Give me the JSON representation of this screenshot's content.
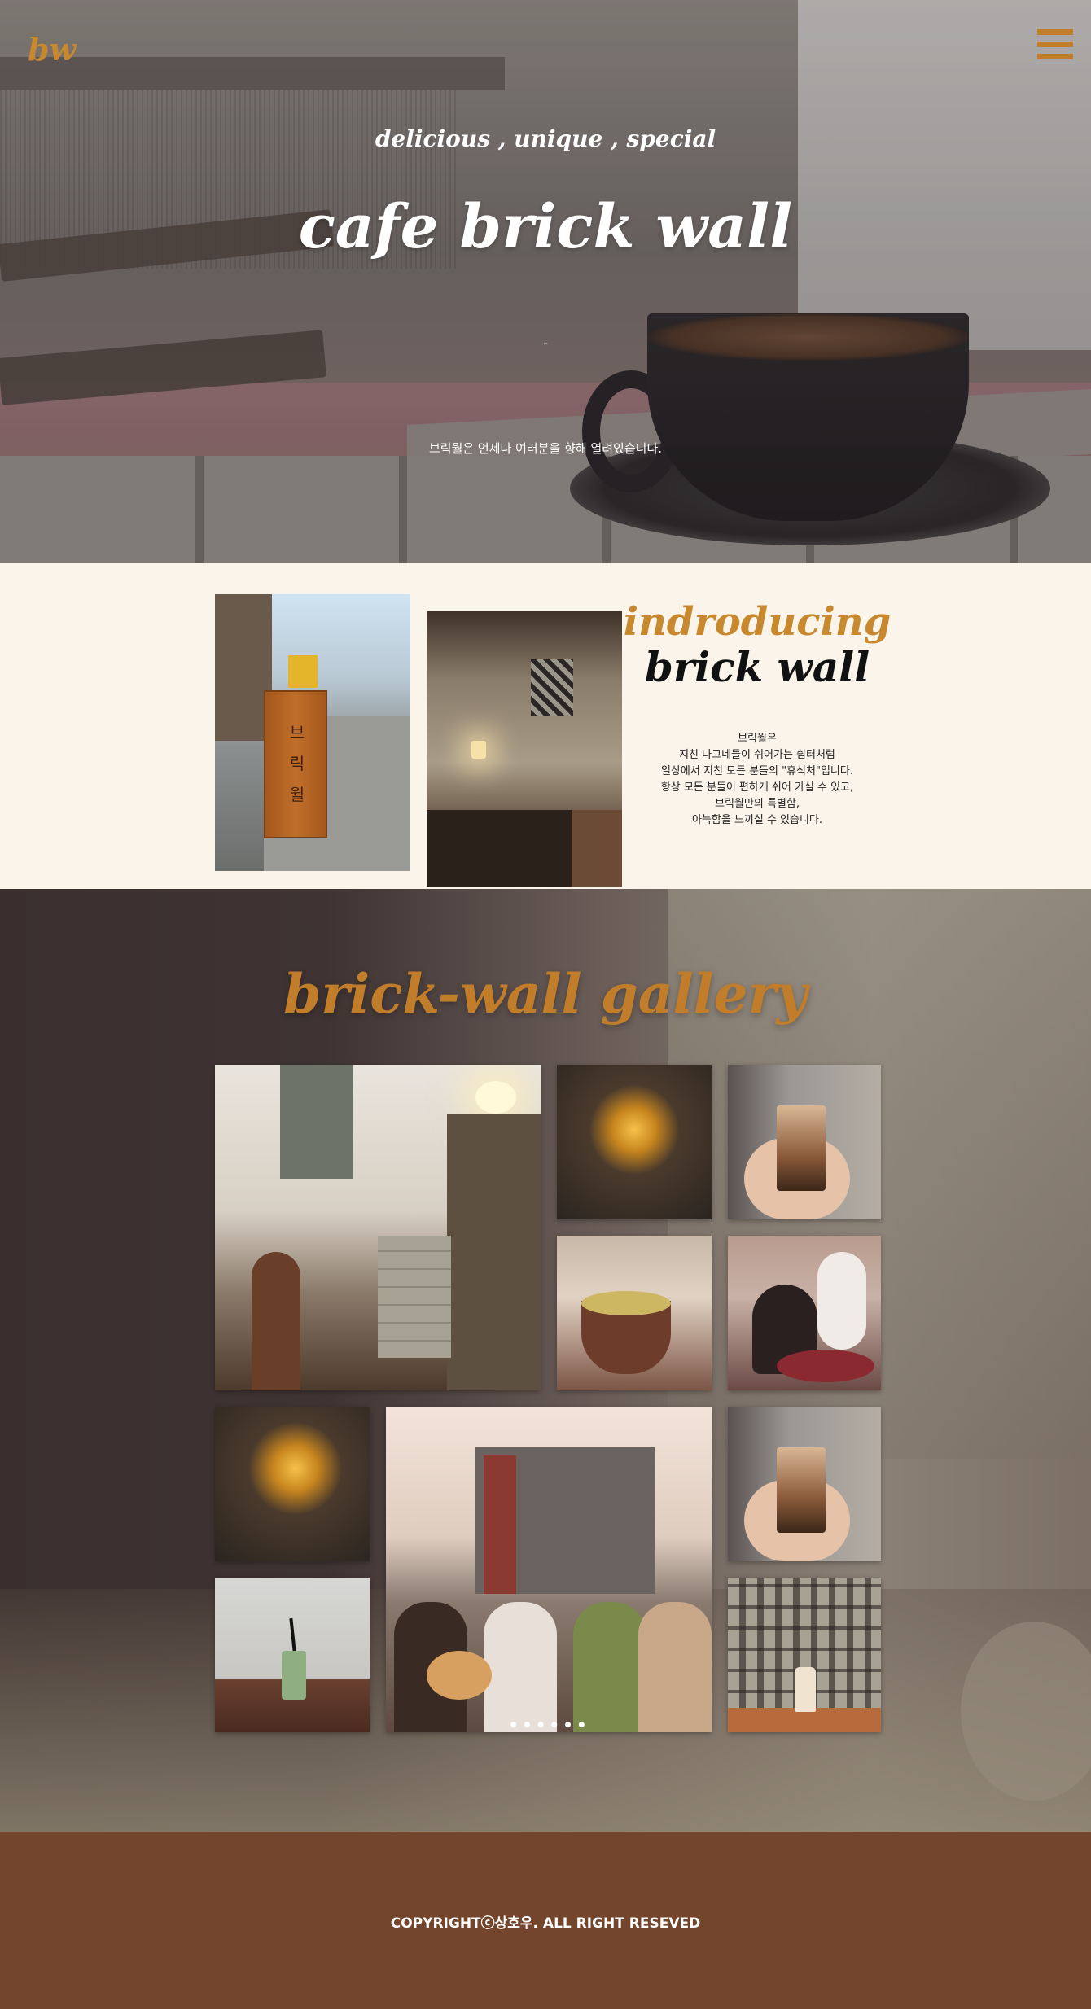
{
  "header": {
    "logo": "bw",
    "menu_icon": "hamburger-menu-icon"
  },
  "hero": {
    "tagline": "delicious , unique , special",
    "title": "cafe brick wall",
    "divider": "-",
    "subtitle": "브릭월은 언제나 여러분을 향해 열려있습니다."
  },
  "intro": {
    "title_line1": "indroducing",
    "title_line2": "brick wall",
    "paragraph": [
      "브릭월은",
      "지친 나그네들이 쉬어가는 쉼터처럼",
      "일상에서 지친 모든 분들의 \"휴식처\"입니다.",
      "항상 모든 분들이 편하게 쉬어 가실 수 있고,",
      "브릭월만의 특별함,",
      "아늑함을 느끼실 수 있습니다."
    ],
    "sign_text": [
      "브",
      "릭",
      "월"
    ]
  },
  "gallery": {
    "title": "brick-wall gallery"
  },
  "footer": {
    "copyright": "COPYRIGHTⓒ상호우. ALL RIGHT RESEVED"
  },
  "colors": {
    "accent": "#c17d2a",
    "cream_bg": "#faf4ea",
    "footer_bg": "#73452d"
  }
}
